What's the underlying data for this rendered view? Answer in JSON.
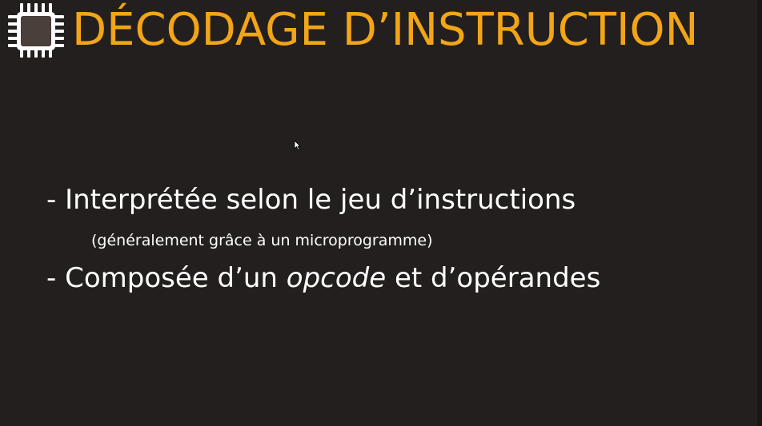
{
  "slide": {
    "title": "DÉCODAGE D’INSTRUCTION",
    "icon": "cpu-chip-icon",
    "accent_color": "#f2a516",
    "background_color": "#241f1f",
    "bullets": [
      {
        "prefix": "- ",
        "text": "Interprétée selon le jeu d’instructions"
      },
      {
        "prefix": "- ",
        "text_before": "Composée d’un ",
        "emphasis": "opcode",
        "text_after": " et d’opérandes"
      }
    ],
    "note": "(généralement grâce à un microprogramme)"
  }
}
